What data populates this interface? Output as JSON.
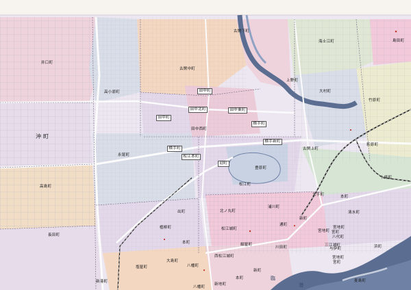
{
  "colors": {
    "paper": "#ece7f0",
    "river": "#5b6e92",
    "river_light": "#8fa2c4",
    "road_main": "#fbfbfb",
    "grid": "#9aa2b8",
    "railway": "#222222",
    "district_pink": "#efd3dc",
    "district_blue": "#d8dde8",
    "district_peach": "#f4d7c0",
    "district_yellow": "#ecebcf",
    "district_green": "#d7e6d4",
    "district_lavender": "#e3d8ea",
    "center_pink": "#f1c9d9"
  },
  "districts": [
    {
      "name": "古閑下町"
    },
    {
      "name": "古閑中町"
    },
    {
      "name": "海士江町"
    },
    {
      "name": "島田町"
    },
    {
      "name": "井口町"
    },
    {
      "name": "高小原町"
    },
    {
      "name": "田中町"
    },
    {
      "name": "田中北町"
    },
    {
      "name": "田中東町"
    },
    {
      "name": "田中西町"
    },
    {
      "name": "田中町"
    },
    {
      "name": "上野町"
    },
    {
      "name": "大村町"
    },
    {
      "name": "竹原町"
    },
    {
      "name": "沖町"
    },
    {
      "name": "横手町"
    },
    {
      "name": "横手新町"
    },
    {
      "name": "古閑上町"
    },
    {
      "name": "永尾町"
    },
    {
      "name": "萩原町"
    },
    {
      "name": "横手町"
    },
    {
      "name": "松江本町"
    },
    {
      "name": "迎町"
    },
    {
      "name": "豊原町"
    },
    {
      "name": "十條町"
    },
    {
      "name": "高島町"
    },
    {
      "name": "松江町"
    },
    {
      "name": "大手町"
    },
    {
      "name": "本町"
    },
    {
      "name": "清水町"
    },
    {
      "name": "北ノ丸町"
    },
    {
      "name": "浦川町"
    },
    {
      "name": "通町"
    },
    {
      "name": "新町"
    },
    {
      "name": "植柳町"
    },
    {
      "name": "出町"
    },
    {
      "name": "宮地町"
    },
    {
      "name": "宮町"
    },
    {
      "name": "八代町"
    },
    {
      "name": "松江城町"
    },
    {
      "name": "長田町"
    },
    {
      "name": "紺屋町"
    },
    {
      "name": "西松江城町"
    },
    {
      "name": "本町"
    },
    {
      "name": "大島町"
    },
    {
      "name": "川田町"
    },
    {
      "name": "三江湖町"
    },
    {
      "name": "浜町"
    },
    {
      "name": "新町"
    },
    {
      "name": "八幡町"
    },
    {
      "name": "本町"
    },
    {
      "name": "塩屋町"
    },
    {
      "name": "麦島町"
    },
    {
      "name": "新地町"
    },
    {
      "name": "与伊町"
    },
    {
      "name": "新港町"
    },
    {
      "name": "臨"
    },
    {
      "name": "港"
    },
    {
      "name": "八幡町"
    },
    {
      "name": "宮地町"
    },
    {
      "name": "宮町"
    },
    {
      "name": "宮地町"
    }
  ]
}
